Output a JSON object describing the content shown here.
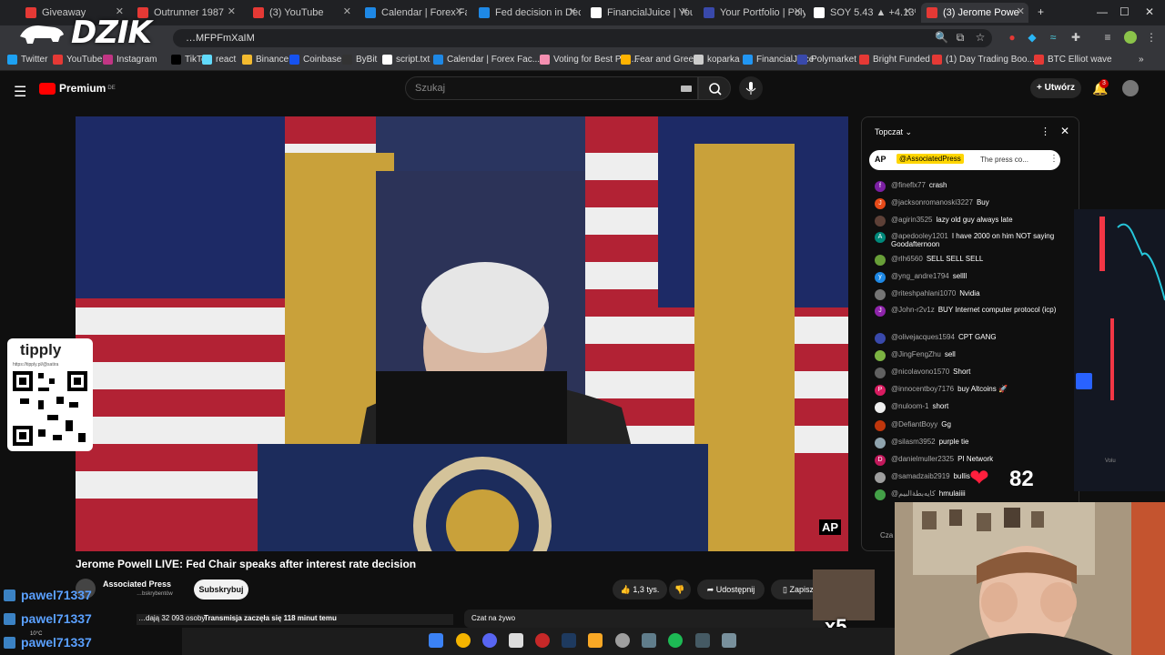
{
  "browser": {
    "tabs": [
      {
        "label": "Giveaway",
        "color": "#e53935"
      },
      {
        "label": "Outrunner 1987",
        "color": "#e53935"
      },
      {
        "label": "(3) YouTube",
        "color": "#e53935"
      },
      {
        "label": "Calendar | Forex Fact",
        "color": "#1e88e5"
      },
      {
        "label": "Fed decision in Dece",
        "color": "#1e88e5"
      },
      {
        "label": "FinancialJuice | Your",
        "color": "#ffffff"
      },
      {
        "label": "Your Portfolio | Polym",
        "color": "#3949ab"
      },
      {
        "label": "SOY 5.43 ▲ +4.13%",
        "color": "#ffffff"
      },
      {
        "label": "(3) Jerome Powe",
        "color": "#e53935"
      }
    ],
    "url": "…MFPFmXaIM",
    "bookmarks": [
      "Twitter",
      "YouTube",
      "Instagram",
      "TikTok",
      "react",
      "Binance",
      "Coinbase",
      "ByBit",
      "script.txt",
      "Calendar | Forex Fac...",
      "Voting for Best Pog...",
      "Fear and Greed",
      "koparka",
      "FinancialJuice",
      "Polymarket",
      "Bright Funded",
      "(1) Day Trading Boo...",
      "BTC Elliot wave"
    ]
  },
  "overlay": {
    "logo": "DZIK",
    "heart_rate": "82",
    "x5_badge": "x5",
    "tipply_title": "tipply",
    "tipply_url": "https://tipply.pl/@satira",
    "pawel_names": [
      "pawel71337",
      "pawel71337",
      "pawel71337"
    ],
    "weather": "10°C"
  },
  "youtube": {
    "brand": "Premium",
    "brand_region": "DE",
    "search_placeholder": "Szukaj",
    "create_label": "Utwórz",
    "notif_count": "3",
    "video_title": "Jerome Powell LIVE: Fed Chair speaks after interest rate decision",
    "channel": "Associated Press",
    "subscribers": "…bskrybentów",
    "subscribe_label": "Subskrybuj",
    "likes": "1,3 tys.",
    "share_label": "Udostępnij",
    "save_label": "Zapisz",
    "watching": "…dają 32 093 osoby",
    "started": "Transmisja zaczęła się 118 minut temu",
    "chat_replay_label": "Czat na żywo",
    "video_watermark": "AP"
  },
  "chat": {
    "header": "Topczat",
    "pinned_author": "@AssociatedPress",
    "pinned_text": "The press co...",
    "messages": [
      {
        "author": "@fineflx77",
        "text": "crash",
        "color": "#7b1fa2",
        "initial": "f"
      },
      {
        "author": "@jacksonromanoski3227",
        "text": "Buy",
        "color": "#e64a19",
        "initial": "J"
      },
      {
        "author": "@agirin3525",
        "text": "lazy old guy always late",
        "color": "#5d4037",
        "initial": ""
      },
      {
        "author": "@apedooley1201",
        "text": "I have 2000 on him NOT saying Goodafternoon",
        "color": "#00897b",
        "initial": "A"
      },
      {
        "author": "@rlh6560",
        "text": "SELL SELL SELL",
        "color": "#689f38",
        "initial": ""
      },
      {
        "author": "@yng_andre1794",
        "text": "sellll",
        "color": "#1e88e5",
        "initial": "y"
      },
      {
        "author": "@riteshpahlani1070",
        "text": "Nvidia",
        "color": "#757575",
        "initial": ""
      },
      {
        "author": "@John-r2v1z",
        "text": "BUY Internet computer protocol (icp)",
        "color": "#8e24aa",
        "initial": "J"
      },
      {
        "author": "@olivejacques1594",
        "text": "CPT GANG",
        "color": "#3949ab",
        "initial": ""
      },
      {
        "author": "@JingFengZhu",
        "text": "sell",
        "color": "#7cb342",
        "initial": ""
      },
      {
        "author": "@nicolavono1570",
        "text": "Short",
        "color": "#616161",
        "initial": ""
      },
      {
        "author": "@innocentboy7176",
        "text": "buy Altcoins 🚀",
        "color": "#d81b60",
        "initial": "P"
      },
      {
        "author": "@nuloom-1",
        "text": "short",
        "color": "#eeeeee",
        "initial": ""
      },
      {
        "author": "@DefiantBoyy",
        "text": "Gg",
        "color": "#bf360c",
        "initial": ""
      },
      {
        "author": "@silasm3952",
        "text": "purple tie",
        "color": "#90a4ae",
        "initial": ""
      },
      {
        "author": "@danielmuller2325",
        "text": "PI Network",
        "color": "#c2185b",
        "initial": "D"
      },
      {
        "author": "@samadzaib2919",
        "text": "bullis",
        "color": "#9e9e9e",
        "initial": ""
      },
      {
        "author": "@كايه‌بطةالبيم",
        "text": "hmulaiiii",
        "color": "#43a047",
        "initial": ""
      }
    ],
    "input_stub": "Cza"
  }
}
